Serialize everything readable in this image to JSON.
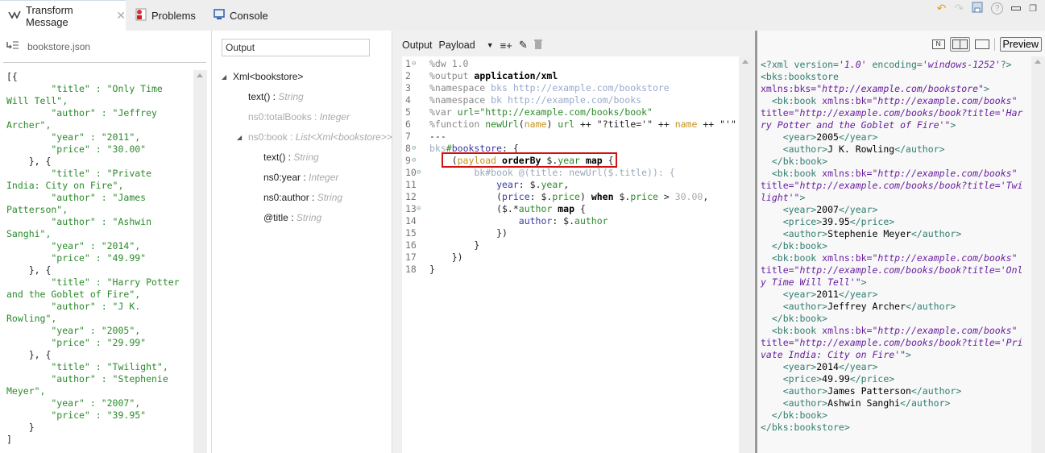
{
  "tabs": [
    {
      "label": "Transform Message",
      "icon": "transform-icon",
      "active": true,
      "closable": true
    },
    {
      "label": "Problems",
      "icon": "problems-icon",
      "active": false
    },
    {
      "label": "Console",
      "icon": "console-icon",
      "active": false
    }
  ],
  "window_icons": [
    "undo-icon",
    "redo-icon",
    "save-icon",
    "help-icon",
    "minimize-icon",
    "restore-icon"
  ],
  "input_panel": {
    "file_name": "bookstore.json",
    "json_lines": [
      "[{",
      "        \"title\" : \"Only Time",
      "Will Tell\",",
      "        \"author\" : \"Jeffrey",
      "Archer\",",
      "        \"year\" : \"2011\",",
      "        \"price\" : \"30.00\"",
      "    }, {",
      "        \"title\" : \"Private",
      "India: City on Fire\",",
      "        \"author\" : \"James",
      "Patterson\",",
      "        \"author\" : \"Ashwin",
      "Sanghi\",",
      "        \"year\" : \"2014\",",
      "        \"price\" : \"49.99\"",
      "    }, {",
      "        \"title\" : \"Harry Potter",
      "and the Goblet of Fire\",",
      "        \"author\" : \"J K.",
      "Rowling\",",
      "        \"year\" : \"2005\",",
      "        \"price\" : \"29.99\"",
      "    }, {",
      "        \"title\" : \"Twilight\",",
      "        \"author\" : \"Stephenie",
      "Meyer\",",
      "        \"year\" : \"2007\",",
      "        \"price\" : \"39.95\"",
      "    }",
      "]"
    ]
  },
  "output_tree": {
    "search_value": "Output",
    "nodes": [
      {
        "name": "Xml<bookstore>",
        "type": "",
        "level": 0,
        "expanded": true,
        "dim": false
      },
      {
        "name": "text() : ",
        "type": "String",
        "level": 1,
        "dim": false
      },
      {
        "name": "ns0:totalBooks : ",
        "type": "Integer",
        "level": 1,
        "dim": true
      },
      {
        "name": "ns0:book : ",
        "type": "List<Xml<bookstore>>",
        "level": 1,
        "expanded": true,
        "dim": true
      },
      {
        "name": "text() : ",
        "type": "String",
        "level": 2,
        "dim": false
      },
      {
        "name": "ns0:year : ",
        "type": "Integer",
        "level": 2,
        "dim": false
      },
      {
        "name": "ns0:author : ",
        "type": "String",
        "level": 2,
        "dim": false
      },
      {
        "name": "@title : ",
        "type": "String",
        "level": 2,
        "dim": false
      }
    ]
  },
  "editor": {
    "toolbar": {
      "output_label": "Output",
      "payload_label": "Payload"
    },
    "line_numbers": [
      "1",
      "2",
      "3",
      "4",
      "5",
      "6",
      "7",
      "8",
      "9",
      "10",
      "11",
      "12",
      "13",
      "14",
      "15",
      "16",
      "17",
      "18"
    ],
    "folded_lines": [
      1,
      8,
      9,
      10,
      13
    ]
  },
  "preview": {
    "button_label": "Preview",
    "view_modes": [
      "source-only-icon",
      "split-view-icon",
      "single-view-icon"
    ]
  }
}
